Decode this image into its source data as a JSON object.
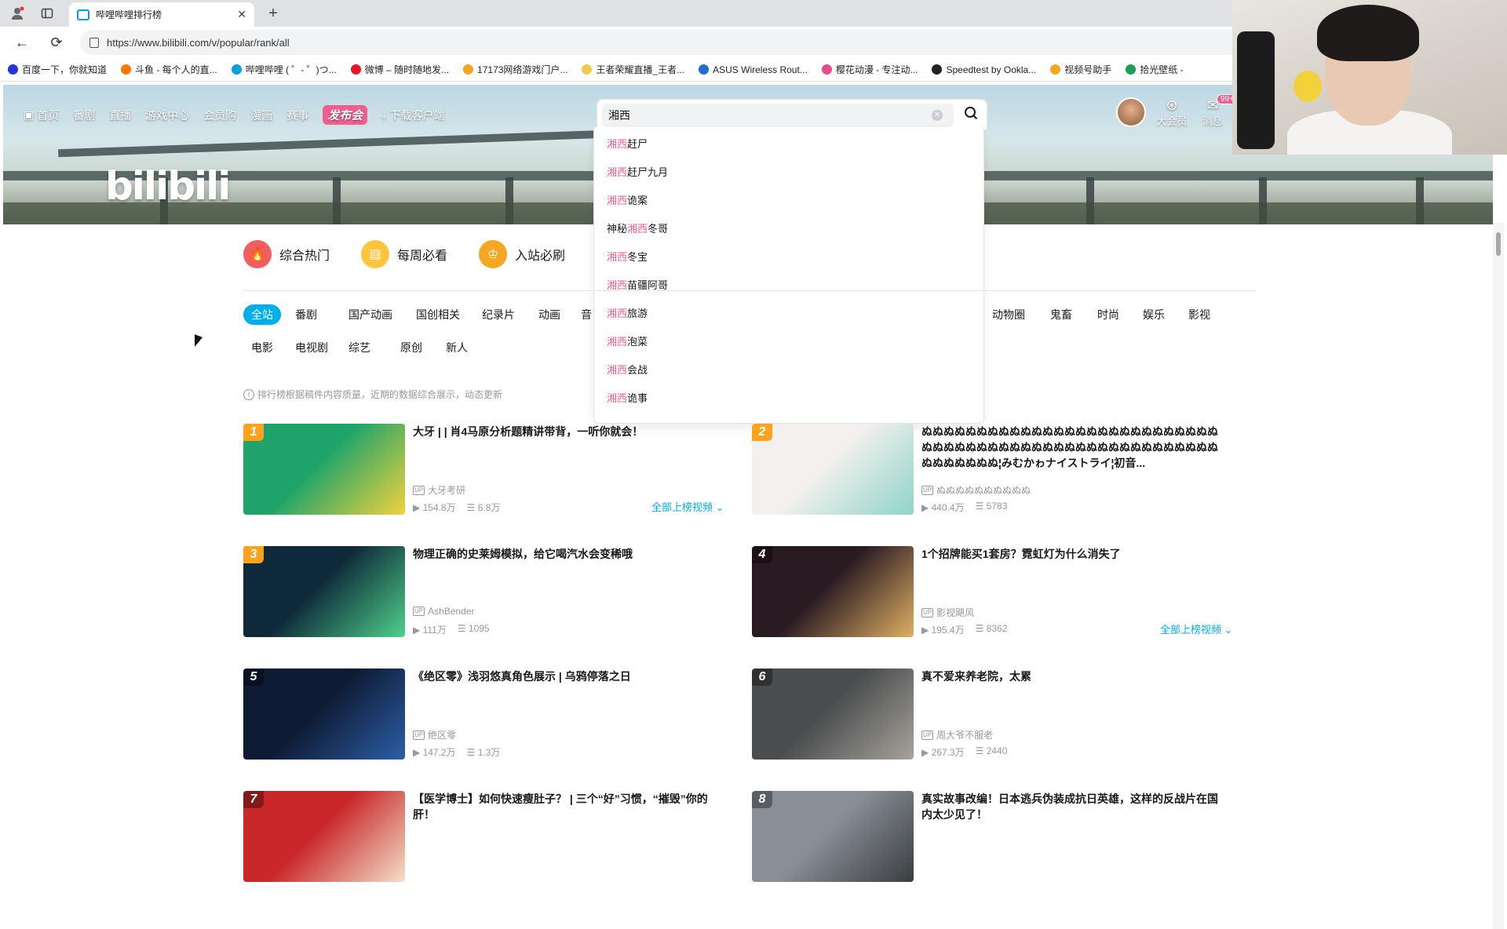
{
  "browser": {
    "tab_title": "哔哩哔哩排行榜",
    "url": "https://www.bilibili.com/v/popular/rank/all",
    "bookmarks": [
      {
        "label": "百度一下，你就知道",
        "color": "#2932e1"
      },
      {
        "label": "斗鱼 - 每个人的直...",
        "color": "#ff7700"
      },
      {
        "label": "哔哩哔哩 ( ゜- ゜)つ...",
        "color": "#00a1d6"
      },
      {
        "label": "微博 – 随时随地发...",
        "color": "#e6162d"
      },
      {
        "label": "17173网络游戏门户...",
        "color": "#f5a623"
      },
      {
        "label": "王者荣耀直播_王者...",
        "color": "#f2c94c"
      },
      {
        "label": "ASUS Wireless Rout...",
        "color": "#1f6fd0"
      },
      {
        "label": "樱花动漫 - 专注动...",
        "color": "#e94b8a"
      },
      {
        "label": "Speedtest by Ookla...",
        "color": "#222222"
      },
      {
        "label": "视频号助手",
        "color": "#f5a623"
      },
      {
        "label": "拾光壁纸 -",
        "color": "#18a058"
      }
    ]
  },
  "header": {
    "nav": [
      {
        "label": "首页",
        "icon": "tv-icon"
      },
      {
        "label": "番剧"
      },
      {
        "label": "直播"
      },
      {
        "label": "游戏中心"
      },
      {
        "label": "会员购"
      },
      {
        "label": "漫画"
      },
      {
        "label": "赛事"
      },
      {
        "label": "发布会",
        "special": true
      },
      {
        "label": "下载客户端",
        "icon": "download-icon"
      }
    ],
    "logo": "bilibili",
    "vip_label": "大会员",
    "message_label": "消息",
    "message_badge": "99+"
  },
  "search": {
    "query": "湘西",
    "suggestions": [
      {
        "pre": "",
        "hl": "湘西",
        "post": "赶尸"
      },
      {
        "pre": "",
        "hl": "湘西",
        "post": "赶尸九月"
      },
      {
        "pre": "",
        "hl": "湘西",
        "post": "诡案"
      },
      {
        "pre": "神秘",
        "hl": "湘西",
        "post": "冬哥"
      },
      {
        "pre": "",
        "hl": "湘西",
        "post": "冬宝"
      },
      {
        "pre": "",
        "hl": "湘西",
        "post": "苗疆阿哥"
      },
      {
        "pre": "",
        "hl": "湘西",
        "post": "旅游"
      },
      {
        "pre": "",
        "hl": "湘西",
        "post": "泡菜"
      },
      {
        "pre": "",
        "hl": "湘西",
        "post": "会战"
      },
      {
        "pre": "",
        "hl": "湘西",
        "post": "诡事"
      }
    ]
  },
  "hot_tabs": [
    {
      "label": "综合热门",
      "color": "#f25d5d",
      "icon": "flame-icon"
    },
    {
      "label": "每周必看",
      "color": "#ffc53d",
      "icon": "calendar-icon"
    },
    {
      "label": "入站必刷",
      "color": "#f5a623",
      "icon": "medal-icon"
    }
  ],
  "categories_row1": [
    "全站",
    "番剧",
    "国产动画",
    "国创相关",
    "纪录片",
    "动画",
    "音"
  ],
  "categories_row1_right": [
    "动物圈",
    "鬼畜",
    "时尚",
    "娱乐",
    "影视"
  ],
  "categories_row2": [
    "电影",
    "电视剧",
    "综艺",
    "原创",
    "新人"
  ],
  "tip": "排行榜根据稿件内容质量，近期的数据综合展示，动态更新",
  "more_label": "全部上榜视频",
  "videos": [
    {
      "rank": "1",
      "title": "大牙 | | 肖4马原分析题精讲带背，一听你就会！",
      "up": "大牙考研",
      "plays": "154.8万",
      "danmaku": "6.8万",
      "c1": "#1fa36a",
      "c2": "#f2d23c"
    },
    {
      "rank": "2",
      "title": "ぬぬぬぬぬぬぬぬぬぬぬぬぬぬぬぬぬぬぬぬぬぬぬぬぬぬぬぬぬぬぬぬぬぬぬぬぬぬぬぬぬぬぬぬぬぬぬぬぬぬぬぬぬぬぬぬぬぬぬぬぬ¦みむかゎナイストライ¦初音...",
      "up": "ぬぬぬぬぬぬぬぬぬぬ",
      "plays": "440.4万",
      "danmaku": "5783",
      "c1": "#f3f0ee",
      "c2": "#8fd3c8"
    },
    {
      "rank": "3",
      "title": "物理正确的史莱姆模拟，给它喝汽水会变稀哦",
      "up": "AshBender",
      "plays": "111万",
      "danmaku": "1095",
      "c1": "#0f2a3a",
      "c2": "#4fd08a"
    },
    {
      "rank": "4",
      "title": "1个招牌能买1套房？霓虹灯为什么消失了",
      "up": "影视飓风",
      "plays": "195.4万",
      "danmaku": "8362",
      "c1": "#2a1a22",
      "c2": "#e0b064"
    },
    {
      "rank": "5",
      "title": "《绝区零》浅羽悠真角色展示 | 乌鸦停落之日",
      "up": "绝区零",
      "plays": "147.2万",
      "danmaku": "1.3万",
      "c1": "#0e1a33",
      "c2": "#2c5fa6"
    },
    {
      "rank": "6",
      "title": "真不爱来养老院，太累",
      "up": "周大爷不服老",
      "plays": "267.3万",
      "danmaku": "2440",
      "c1": "#4a4c4e",
      "c2": "#a7a39c"
    },
    {
      "rank": "7",
      "title": "【医学博士】如何快速瘦肚子？ | 三个“好”习惯，“摧毁”你的肝！",
      "up": "",
      "plays": "",
      "danmaku": "",
      "c1": "#c8282a",
      "c2": "#f4e0c8"
    },
    {
      "rank": "8",
      "title": "真实故事改编！日本逃兵伪装成抗日英雄，这样的反战片在国内太少见了！",
      "up": "",
      "plays": "",
      "danmaku": "",
      "c1": "#8a8f95",
      "c2": "#3a3d40"
    }
  ]
}
